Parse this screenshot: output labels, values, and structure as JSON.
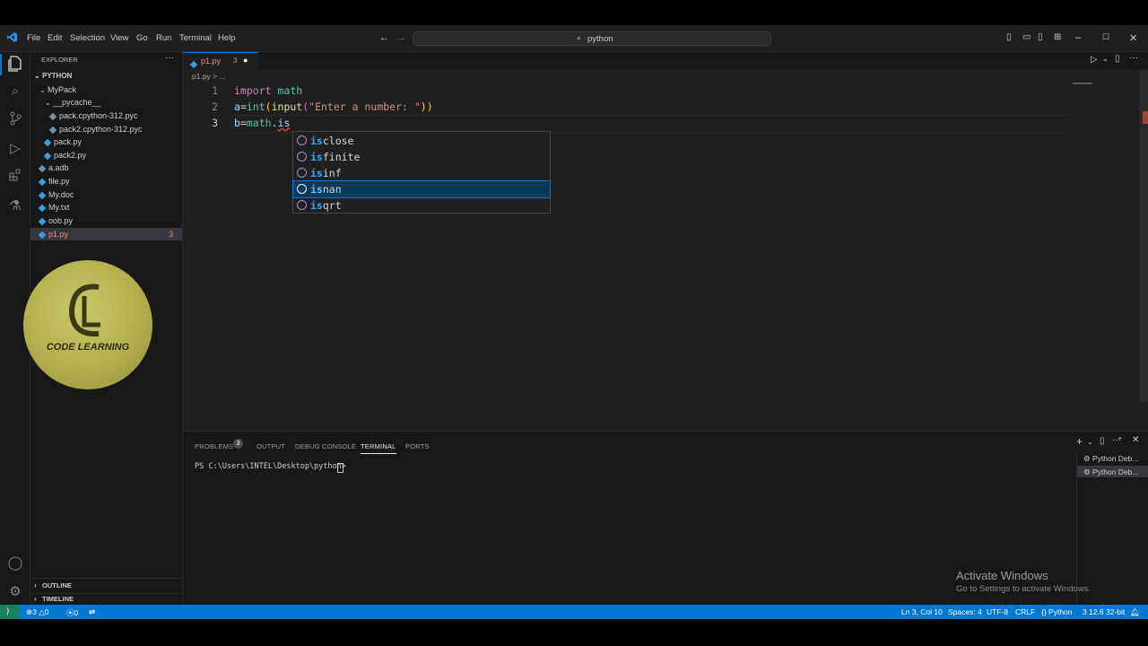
{
  "menu": [
    "File",
    "Edit",
    "Selection",
    "View",
    "Go",
    "Run",
    "Terminal",
    "Help"
  ],
  "search": {
    "text": "python"
  },
  "explorer": {
    "header": "EXPLORER",
    "root": "PYTHON",
    "items": [
      {
        "label": "MyPack",
        "kind": "folder"
      },
      {
        "label": "__pycache__",
        "kind": "folder"
      },
      {
        "label": "pack.cpython-312.pyc",
        "kind": "file"
      },
      {
        "label": "pack2.cpython-312.pyc",
        "kind": "file"
      },
      {
        "label": "pack.py",
        "kind": "py"
      },
      {
        "label": "pack2.py",
        "kind": "py"
      },
      {
        "label": "a.adb",
        "kind": "file"
      },
      {
        "label": "file.py",
        "kind": "py"
      },
      {
        "label": "My.doc",
        "kind": "file"
      },
      {
        "label": "My.txt",
        "kind": "file"
      },
      {
        "label": "oob.py",
        "kind": "py"
      },
      {
        "label": "p1.py",
        "kind": "py",
        "badge": "3"
      }
    ],
    "outline": "OUTLINE",
    "timeline": "TIMELINE"
  },
  "logo": {
    "text": "CODE LEARNING"
  },
  "editor": {
    "tab_label": "p1.py",
    "tab_badge": "3",
    "breadcrumb": "p1.py > ...",
    "line_numbers": [
      "1",
      "2",
      "3"
    ],
    "line1": {
      "kw": "import",
      "rest": " math"
    },
    "line2": {
      "a": "a",
      "eq": "=",
      "int": "int",
      "p1": "(",
      "input": "input",
      "p2": "(",
      "str": "\"Enter a number: \"",
      "p3": "))"
    },
    "line3": {
      "b": "b",
      "eq": "=",
      "math": "math",
      "dot": ".",
      "is": "is"
    },
    "suggestions": [
      {
        "match": "is",
        "rest": "close"
      },
      {
        "match": "is",
        "rest": "finite"
      },
      {
        "match": "is",
        "rest": "inf"
      },
      {
        "match": "is",
        "rest": "nan"
      },
      {
        "match": "is",
        "rest": "qrt"
      }
    ]
  },
  "panel": {
    "tabs": [
      "PROBLEMS",
      "OUTPUT",
      "DEBUG CONSOLE",
      "TERMINAL",
      "PORTS"
    ],
    "problems_count": "3",
    "prompt": "PS C:\\Users\\INTEL\\Desktop\\python>",
    "terminals": [
      "Python Deb...",
      "Python Deb..."
    ]
  },
  "status": {
    "errors": "3",
    "warnings": "0",
    "ports": "0",
    "position": "Ln 3, Col 10",
    "spaces": "Spaces: 4",
    "encoding": "UTF-8",
    "eol": "CRLF",
    "language": "Python",
    "interpreter": "3.12.6 32-bit"
  },
  "watermark": {
    "title": "Activate Windows",
    "subtitle": "Go to Settings to activate Windows."
  },
  "colors": {
    "accent": "#0078d4",
    "selection": "#04395e",
    "match": "#2aaaff"
  }
}
